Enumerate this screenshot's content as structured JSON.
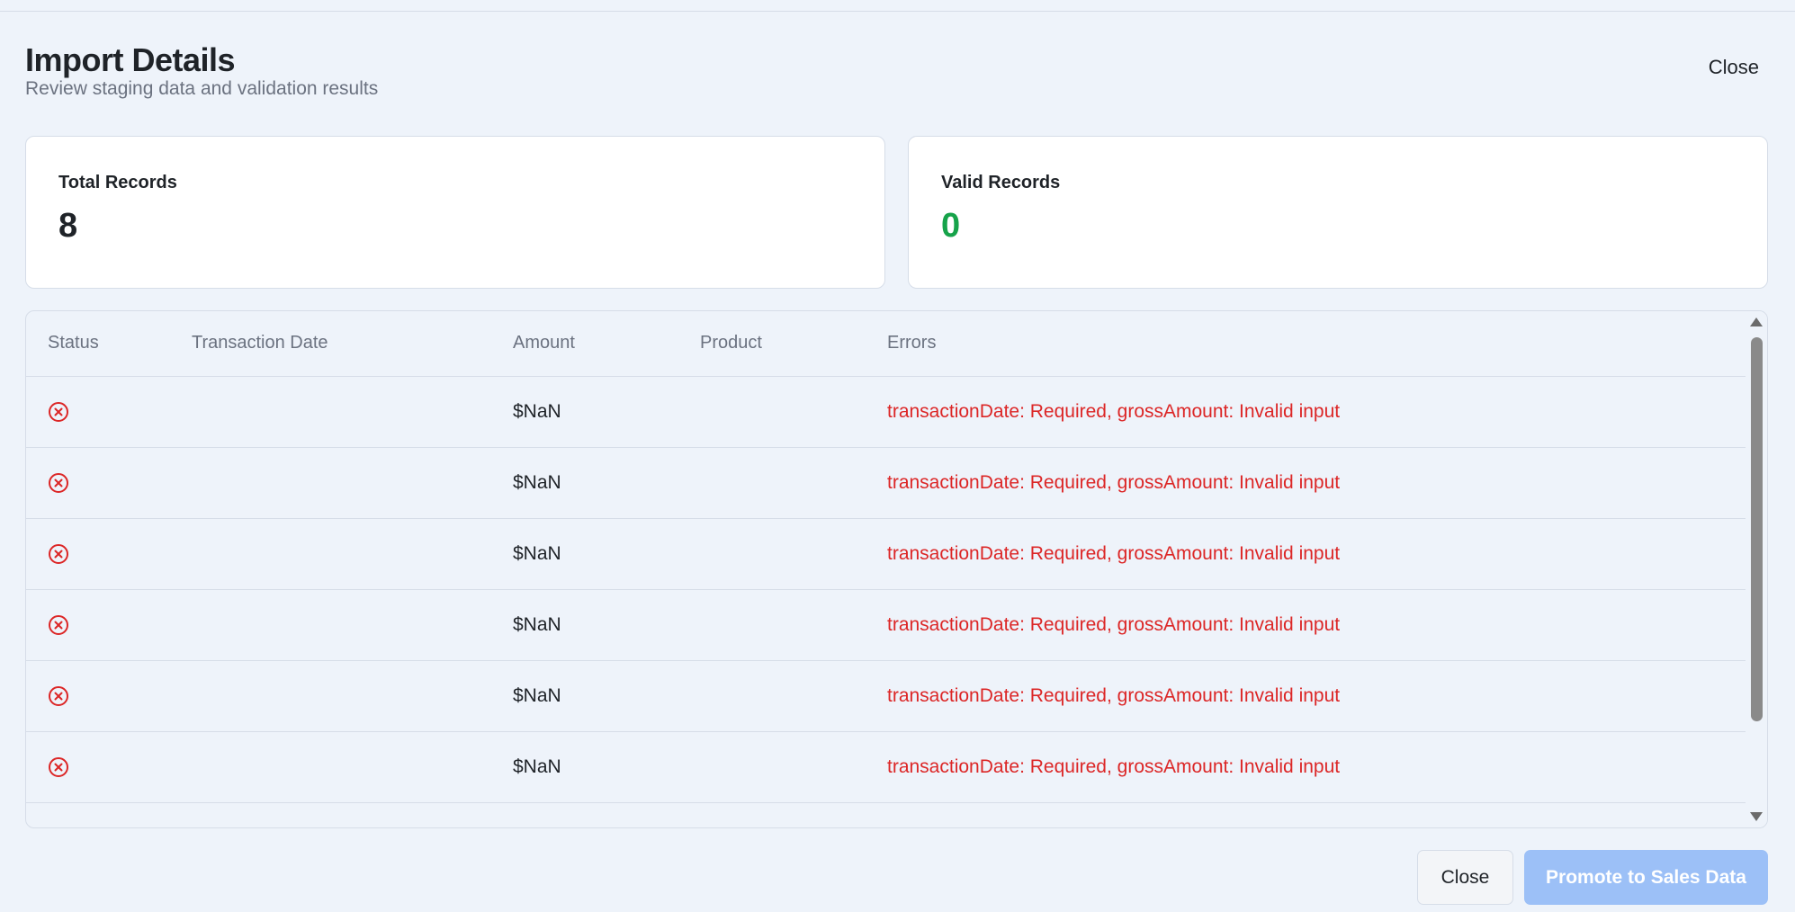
{
  "header": {
    "title": "Import Details",
    "subtitle": "Review staging data and validation results",
    "close_label": "Close"
  },
  "stats": {
    "total_label": "Total Records",
    "total_value": "8",
    "valid_label": "Valid Records",
    "valid_value": "0",
    "valid_color": "#16a34a"
  },
  "table": {
    "columns": [
      "Status",
      "Transaction Date",
      "Amount",
      "Product",
      "Errors"
    ],
    "rows": [
      {
        "status_icon": "x-circle-icon",
        "transaction_date": "",
        "amount": "$NaN",
        "product": "",
        "errors": "transactionDate: Required, grossAmount: Invalid input"
      },
      {
        "status_icon": "x-circle-icon",
        "transaction_date": "",
        "amount": "$NaN",
        "product": "",
        "errors": "transactionDate: Required, grossAmount: Invalid input"
      },
      {
        "status_icon": "x-circle-icon",
        "transaction_date": "",
        "amount": "$NaN",
        "product": "",
        "errors": "transactionDate: Required, grossAmount: Invalid input"
      },
      {
        "status_icon": "x-circle-icon",
        "transaction_date": "",
        "amount": "$NaN",
        "product": "",
        "errors": "transactionDate: Required, grossAmount: Invalid input"
      },
      {
        "status_icon": "x-circle-icon",
        "transaction_date": "",
        "amount": "$NaN",
        "product": "",
        "errors": "transactionDate: Required, grossAmount: Invalid input"
      },
      {
        "status_icon": "x-circle-icon",
        "transaction_date": "",
        "amount": "$NaN",
        "product": "",
        "errors": "transactionDate: Required, grossAmount: Invalid input"
      }
    ],
    "error_color": "#dc2626"
  },
  "footer": {
    "close_label": "Close",
    "promote_label": "Promote to Sales Data",
    "promote_color": "#9cc0f7"
  }
}
